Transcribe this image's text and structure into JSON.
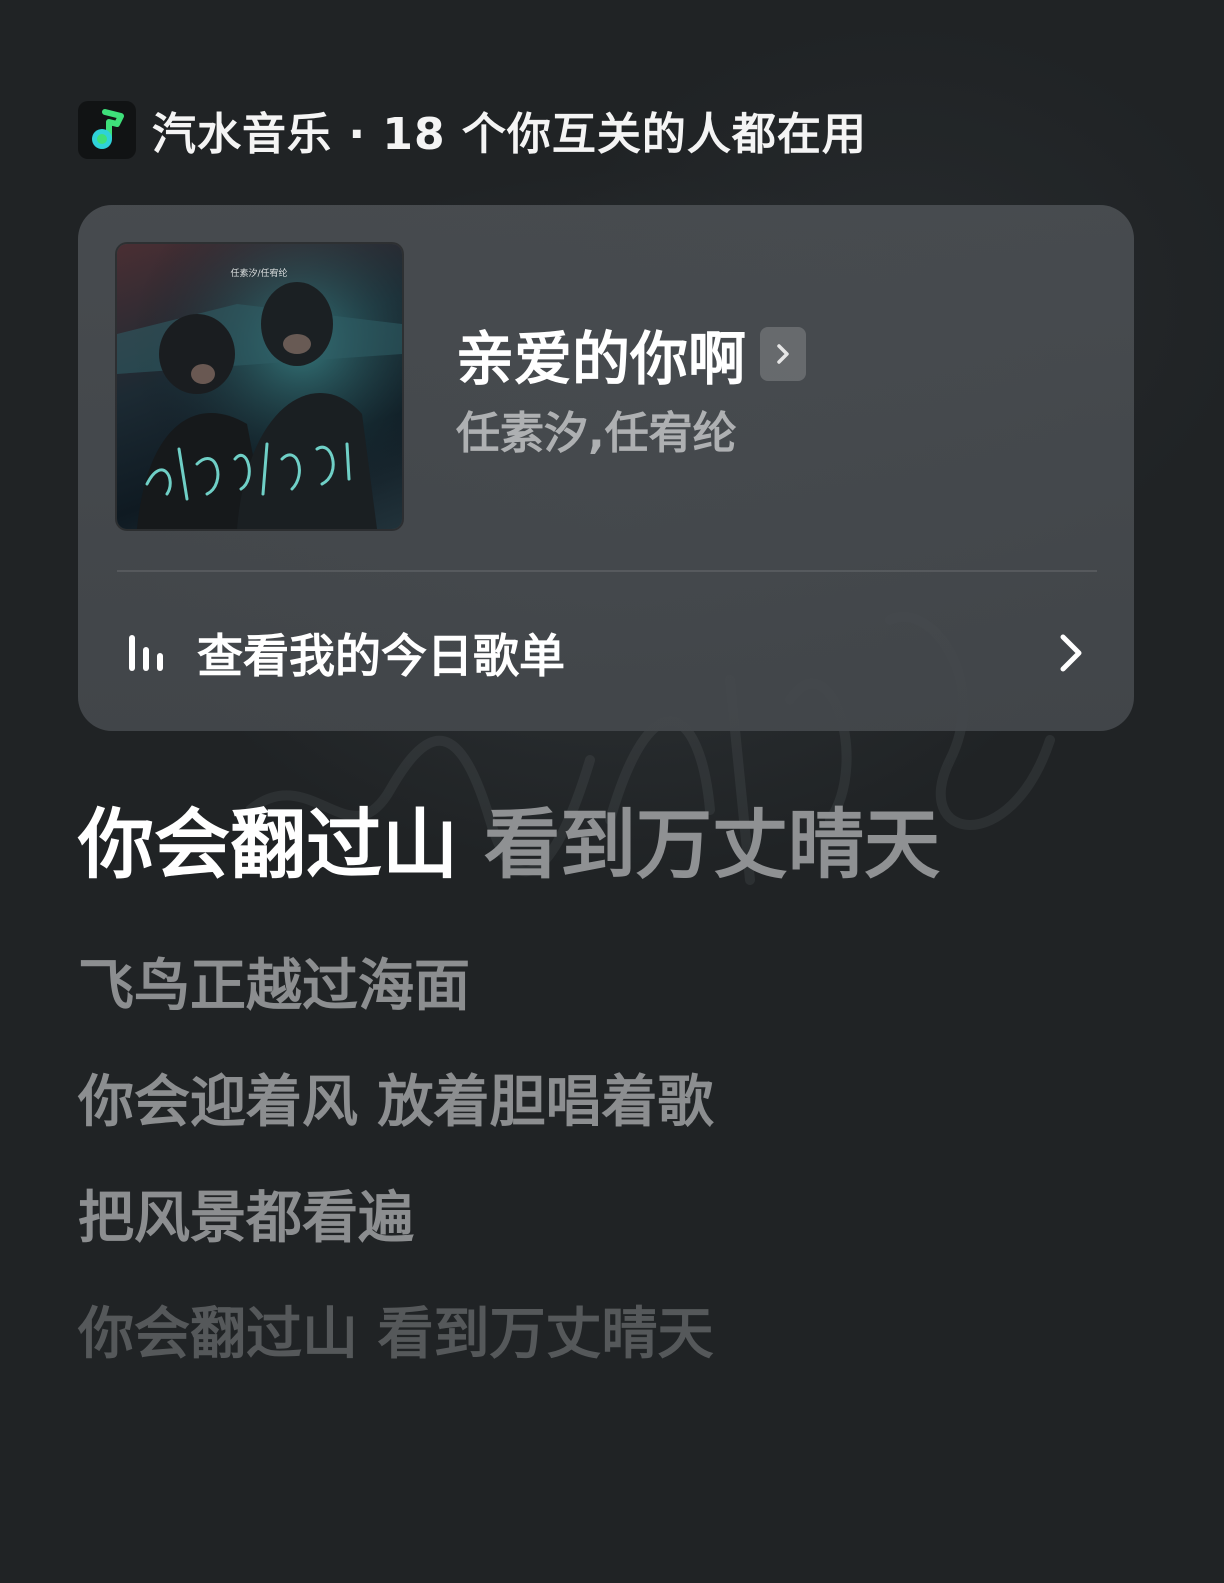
{
  "header": {
    "app_name": "汽水音乐",
    "separator": "·",
    "social_text": "18 个你互关的人都在用",
    "logo_icon": "music-note-icon"
  },
  "song_card": {
    "title": "亲爱的你啊",
    "artist": "任素汐,任宥纶",
    "cover_artist_text": "任素汐/任宥纶",
    "cover_title_text": "亲爱的你啊",
    "playlist_label": "查看我的今日歌单",
    "icons": {
      "title_chevron": "chevron-right-icon",
      "playlist": "audio-bars-icon",
      "row_chevron": "chevron-right-icon"
    }
  },
  "lyrics": {
    "current_sung": "你会翻过山",
    "current_unsung": "看到万丈晴天",
    "next_lines": [
      "飞鸟正越过海面",
      "你会迎着风 放着胆唱着歌",
      "把风景都看遍",
      "你会翻过山 看到万丈晴天"
    ]
  },
  "colors": {
    "background": "#202325",
    "card": "#4a4e52",
    "logo_green": "#3ee07a",
    "logo_cyan": "#2fd2d8",
    "lyric_active": "#ffffff",
    "lyric_inactive": "#8c8e90"
  }
}
